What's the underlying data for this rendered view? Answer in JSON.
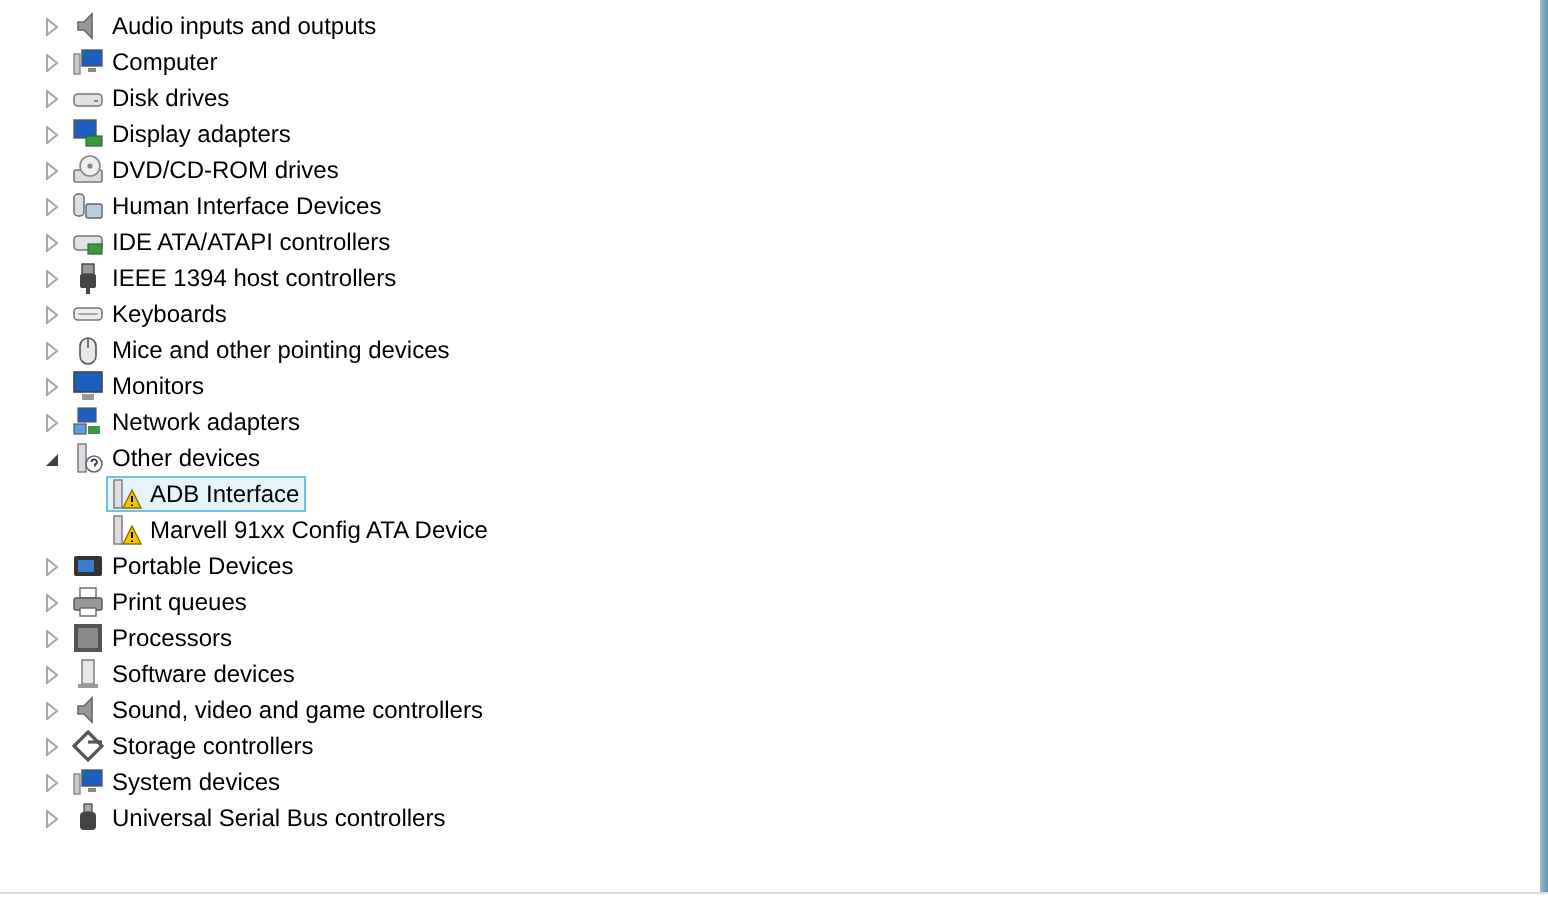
{
  "tree": [
    {
      "label": "Audio inputs and outputs",
      "expanded": false,
      "selected": false
    },
    {
      "label": "Computer",
      "expanded": false,
      "selected": false
    },
    {
      "label": "Disk drives",
      "expanded": false,
      "selected": false
    },
    {
      "label": "Display adapters",
      "expanded": false,
      "selected": false
    },
    {
      "label": "DVD/CD-ROM drives",
      "expanded": false,
      "selected": false
    },
    {
      "label": "Human Interface Devices",
      "expanded": false,
      "selected": false
    },
    {
      "label": "IDE ATA/ATAPI controllers",
      "expanded": false,
      "selected": false
    },
    {
      "label": "IEEE 1394 host controllers",
      "expanded": false,
      "selected": false
    },
    {
      "label": "Keyboards",
      "expanded": false,
      "selected": false
    },
    {
      "label": "Mice and other pointing devices",
      "expanded": false,
      "selected": false
    },
    {
      "label": "Monitors",
      "expanded": false,
      "selected": false
    },
    {
      "label": "Network adapters",
      "expanded": false,
      "selected": false
    },
    {
      "label": "Other devices",
      "expanded": true,
      "selected": false,
      "children": [
        {
          "label": "ADB Interface",
          "selected": true
        },
        {
          "label": "Marvell 91xx Config ATA Device",
          "selected": false
        }
      ]
    },
    {
      "label": "Portable Devices",
      "expanded": false,
      "selected": false
    },
    {
      "label": "Print queues",
      "expanded": false,
      "selected": false
    },
    {
      "label": "Processors",
      "expanded": false,
      "selected": false
    },
    {
      "label": "Software devices",
      "expanded": false,
      "selected": false
    },
    {
      "label": "Sound, video and game controllers",
      "expanded": false,
      "selected": false
    },
    {
      "label": "Storage controllers",
      "expanded": false,
      "selected": false
    },
    {
      "label": "System devices",
      "expanded": false,
      "selected": false
    },
    {
      "label": "Universal Serial Bus controllers",
      "expanded": false,
      "selected": false
    }
  ]
}
